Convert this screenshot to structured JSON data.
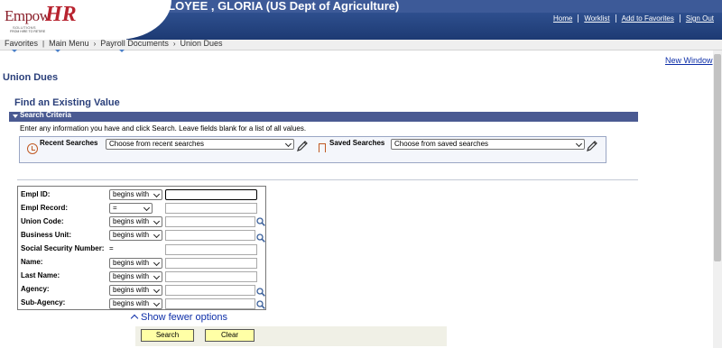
{
  "header": {
    "user_title": "EMPLOYEE , GLORIA (US Dept of Agriculture)",
    "links": [
      "Home",
      "Worklist",
      "Add to Favorites",
      "Sign Out"
    ]
  },
  "logo": {
    "brand_left": "Empow",
    "brand_right": "HR",
    "line1": "SOLUTIONS",
    "line2": "FROM HIRE TO RETIRE"
  },
  "breadcrumb": [
    "Favorites",
    "Main Menu",
    "Payroll Documents",
    "Union Dues"
  ],
  "new_window": "New Window",
  "page_title": "Union Dues",
  "find_title": "Find an Existing Value",
  "section_label": "Search Criteria",
  "instructions": "Enter any information you have and click Search. Leave fields blank for a list of all values.",
  "recent_searches": {
    "label": "Recent Searches",
    "value": "Choose from recent searches"
  },
  "saved_searches": {
    "label": "Saved Searches",
    "value": "Choose from saved searches"
  },
  "fields": [
    {
      "label": "Empl ID:",
      "operator": "begins with",
      "value": ""
    },
    {
      "label": "Empl Record:",
      "operator": "=",
      "value": ""
    },
    {
      "label": "Union Code:",
      "operator": "begins with",
      "value": ""
    },
    {
      "label": "Business Unit:",
      "operator": "begins with",
      "value": ""
    },
    {
      "label": "Social Security Number:",
      "operator": "=",
      "value": ""
    },
    {
      "label": "Name:",
      "operator": "begins with",
      "value": ""
    },
    {
      "label": "Last Name:",
      "operator": "begins with",
      "value": ""
    },
    {
      "label": "Agency:",
      "operator": "begins with",
      "value": ""
    },
    {
      "label": "Sub-Agency:",
      "operator": "begins with",
      "value": ""
    }
  ],
  "show_fewer": "Show fewer options",
  "buttons": {
    "search": "Search",
    "clear": "Clear"
  },
  "colors": {
    "header_blue": "#1d3a73",
    "section_bar": "#4a5a92",
    "link": "#0d2ea8",
    "button": "#ffffa6",
    "brand_red": "#b8232f"
  },
  "icons": [
    "history-icon",
    "bookmark-icon",
    "pencil-icon",
    "lookup-magnifier-icon",
    "chevron-down-icon",
    "chevron-up-icon"
  ]
}
